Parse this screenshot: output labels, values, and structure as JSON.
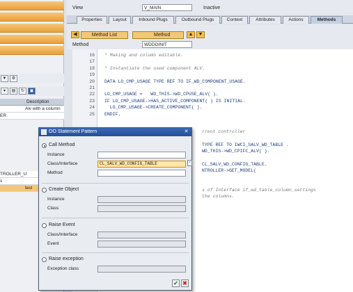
{
  "top": {
    "view_label": "View",
    "view_value": "V_MAIN",
    "view_status": "Inactive",
    "method_label": "Method",
    "method_value": "WDDOINIT"
  },
  "tabs": [
    "Properties",
    "Layout",
    "Inbound Plugs",
    "Outbound Plugs",
    "Context",
    "Attributes",
    "Actions",
    "Methods"
  ],
  "nav": {
    "method_list": "Method List",
    "method": "Method"
  },
  "left": {
    "col_description": "Description",
    "cells": [
      "Alv with a column",
      "ER",
      "TROLLER_U",
      "s",
      "test",
      "test"
    ]
  },
  "code": [
    {
      "n": "16",
      "t": "* Making and column editable.",
      "c": true
    },
    {
      "n": "17",
      "t": "",
      "c": false
    },
    {
      "n": "18",
      "t": "* Instantiate the used component ALV.",
      "c": true
    },
    {
      "n": "19",
      "t": "",
      "c": false
    },
    {
      "n": "20",
      "t": "DATA LO_CMP_USAGE TYPE REF TO IF_WD_COMPONENT_USAGE.",
      "c": false
    },
    {
      "n": "21",
      "t": "",
      "c": false
    },
    {
      "n": "22",
      "t": "LO_CMP_USAGE =   WD_THIS->WD_CPUSE_ALV( ).",
      "c": false
    },
    {
      "n": "23",
      "t": "IF LO_CMP_USAGE->HAS_ACTIVE_COMPONENT( ) IS INITIAL.",
      "c": false
    },
    {
      "n": "24",
      "t": "  LO_CMP_USAGE->CREATE_COMPONENT( ).",
      "c": false
    },
    {
      "n": "25",
      "t": "ENDIF.",
      "c": false
    }
  ],
  "code_tail": [
    "rrent controller",
    "TYPE REF TO IWCI_SALV_WD_TABLE .",
    "WD_THIS->WD_CPIFC_ALV( ).",
    "CL_SALV_WD_CONFIG_TABLE.",
    "NTROLLER->GET_MODEL(",
    "s of Interface if_wd_table_column_settings",
    "the columns."
  ],
  "dialog": {
    "title": "OO Statement Pattern",
    "call_method": "Call Method",
    "instance": "Instance",
    "class_interface": "Class/Interface",
    "method": "Method",
    "class_value": "CL_SALV_WD_CONFIG_TABLE",
    "create_object": "Create Object",
    "co_instance": "Instance",
    "co_class": "Class",
    "raise_event": "Raise Event",
    "re_class_interface": "Class/Interface",
    "re_event": "Event",
    "raise_exception": "Raise exception",
    "exception_class": "Exception class",
    "ok": "✔",
    "cancel": "✖",
    "close": "✕"
  }
}
